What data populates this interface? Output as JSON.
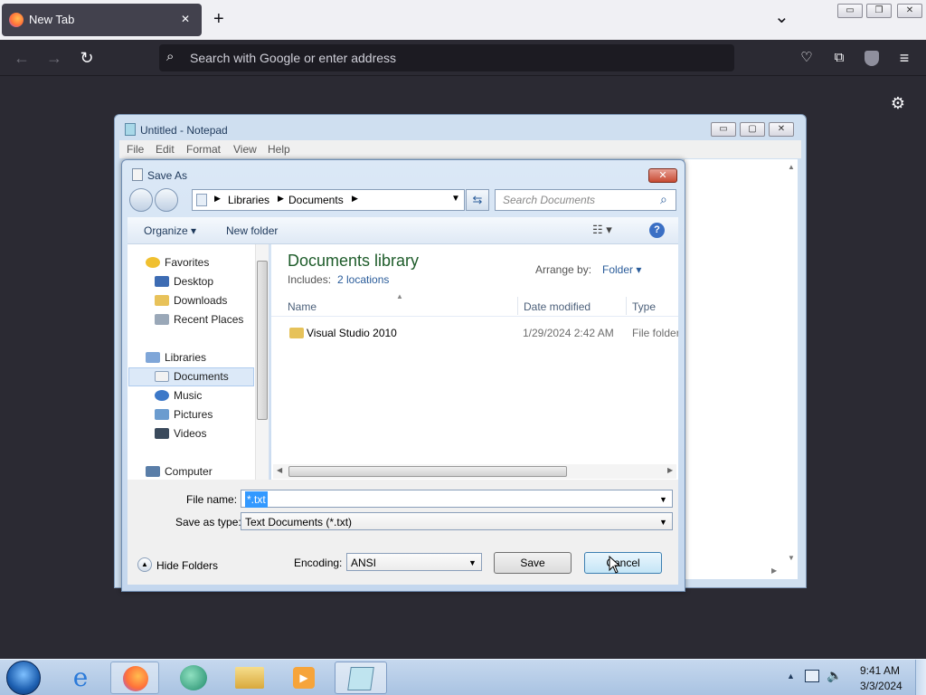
{
  "browser": {
    "tab_title": "New Tab",
    "tab_close": "✕",
    "new_tab": "+",
    "tab_list": "⌄",
    "url_placeholder": "Search with Google or enter address",
    "win_min": "▭",
    "win_restore": "❐",
    "win_close": "✕"
  },
  "notepad": {
    "title": "Untitled - Notepad",
    "menu": [
      "File",
      "Edit",
      "Format",
      "View",
      "Help"
    ]
  },
  "dialog": {
    "title": "Save As",
    "breadcrumb": [
      "Libraries",
      "Documents"
    ],
    "search_placeholder": "Search Documents",
    "organize": "Organize ▾",
    "new_folder": "New folder",
    "library_title": "Documents library",
    "includes_label": "Includes:",
    "includes_link": "2 locations",
    "arrange_label": "Arrange by:",
    "arrange_value": "Folder ▾",
    "columns": [
      "Name",
      "Date modified",
      "Type"
    ],
    "rows": [
      {
        "name": "Visual Studio 2010",
        "date": "1/29/2024 2:42 AM",
        "type": "File folder"
      }
    ],
    "nav": {
      "favorites": "Favorites",
      "desktop": "Desktop",
      "downloads": "Downloads",
      "recent": "Recent Places",
      "libraries": "Libraries",
      "documents": "Documents",
      "music": "Music",
      "pictures": "Pictures",
      "videos": "Videos",
      "computer": "Computer"
    },
    "file_name_label": "File name:",
    "file_name_value": "*.txt",
    "type_label": "Save as type:",
    "type_value": "Text Documents (*.txt)",
    "hide_folders": "Hide Folders",
    "encoding_label": "Encoding:",
    "encoding_value": "ANSI",
    "save_label": "Save",
    "cancel_label": "Cancel"
  },
  "taskbar": {
    "time": "9:41 AM",
    "date": "3/3/2024"
  }
}
